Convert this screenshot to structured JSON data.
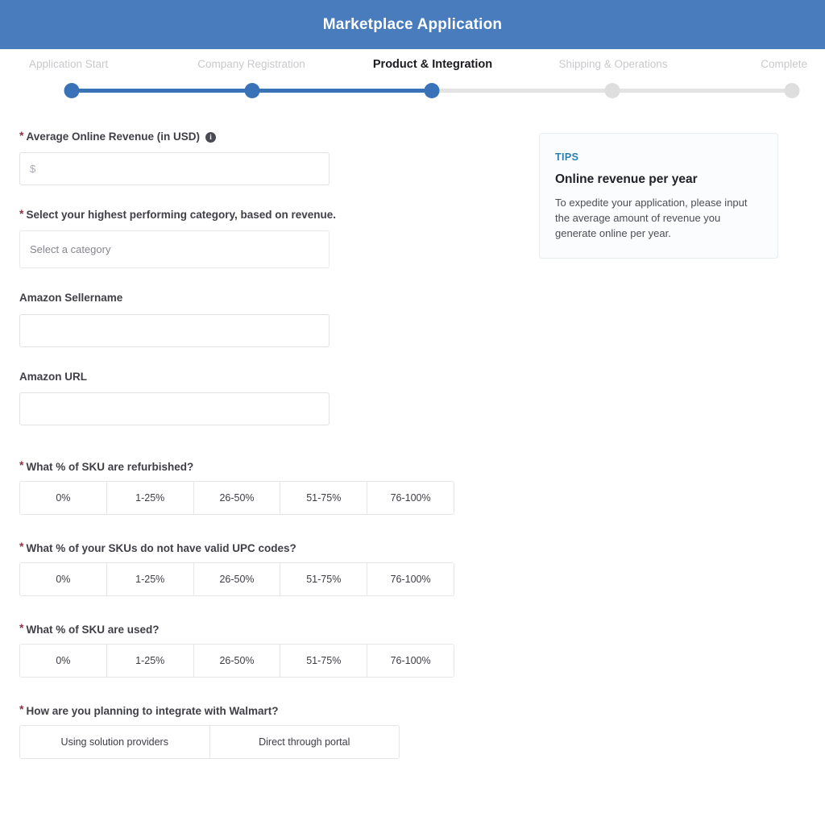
{
  "header": {
    "title": "Marketplace Application",
    "background_color": "#487cbc"
  },
  "stepper": {
    "active_index": 2,
    "done_color": "#3a72b8",
    "todo_color": "#dedede",
    "steps": [
      {
        "label": "Application Start",
        "state": "done"
      },
      {
        "label": "Company Registration",
        "state": "done"
      },
      {
        "label": "Product & Integration",
        "state": "active"
      },
      {
        "label": "Shipping & Operations",
        "state": "todo"
      },
      {
        "label": "Complete",
        "state": "todo"
      }
    ]
  },
  "form": {
    "revenue": {
      "label": "Average Online Revenue (in USD)",
      "required": true,
      "info_icon": "info-icon",
      "info_glyph": "i",
      "placeholder": "$",
      "value": ""
    },
    "category": {
      "label": "Select your highest performing category, based on revenue.",
      "required": true,
      "selected": "Select a category"
    },
    "amazon_sellername": {
      "label": "Amazon Sellername",
      "required": false,
      "placeholder": "",
      "value": ""
    },
    "amazon_url": {
      "label": "Amazon URL",
      "required": false,
      "placeholder": "",
      "value": ""
    },
    "segmented": [
      {
        "label": "What % of SKU are refurbished?",
        "required": true,
        "options": [
          "0%",
          "1-25%",
          "26-50%",
          "51-75%",
          "76-100%"
        ],
        "selected": null
      },
      {
        "label": "What % of your SKUs do not have valid UPC codes?",
        "required": true,
        "options": [
          "0%",
          "1-25%",
          "26-50%",
          "51-75%",
          "76-100%"
        ],
        "selected": null
      },
      {
        "label": "What % of SKU are used?",
        "required": true,
        "options": [
          "0%",
          "1-25%",
          "26-50%",
          "51-75%",
          "76-100%"
        ],
        "selected": null
      },
      {
        "label": "How are you planning to integrate with Walmart?",
        "required": true,
        "options": [
          "Using solution providers",
          "Direct through portal"
        ],
        "selected": null
      }
    ],
    "required_marker": "*"
  },
  "tips": {
    "kicker": "TIPS",
    "kicker_color": "#2a7fae",
    "heading": "Online revenue per year",
    "body": "To expedite your application, please input the average amount of revenue you generate online per year."
  }
}
